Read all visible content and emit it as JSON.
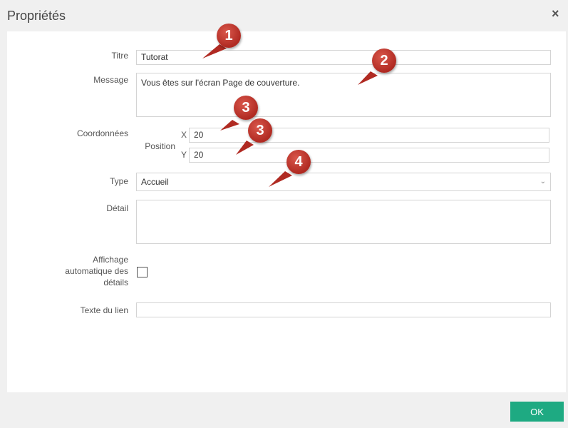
{
  "dialog": {
    "title": "Propriétés",
    "close_symbol": "×"
  },
  "form": {
    "titre_label": "Titre",
    "titre_value": "Tutorat",
    "message_label": "Message",
    "message_value": "Vous êtes sur l'écran Page de couverture.",
    "coordonnees_label": "Coordonnées",
    "position_label": "Position",
    "x_label": "X",
    "x_value": "20",
    "y_label": "Y",
    "y_value": "20",
    "type_label": "Type",
    "type_value": "Accueil",
    "type_arrow": "⌄",
    "detail_label": "Détail",
    "detail_value": "",
    "affichage_label_line1": "Affichage",
    "affichage_label_line2": "automatique des",
    "affichage_label_line3": "détails",
    "affichage_checked": false,
    "lien_label": "Texte du lien",
    "lien_value": ""
  },
  "callouts": [
    "1",
    "2",
    "3",
    "3",
    "4"
  ],
  "footer": {
    "ok_label": "OK"
  },
  "colors": {
    "ok_button": "#1eaa82",
    "callout": "#c0392b"
  },
  "icons": {
    "close": "close-icon",
    "dropdown": "chevron-down-icon"
  }
}
